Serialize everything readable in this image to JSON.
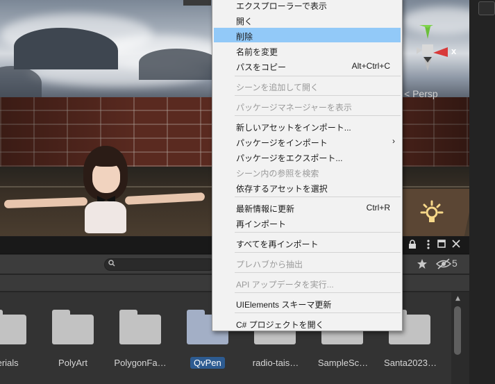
{
  "scene": {
    "projection_label": "< Persp",
    "gizmo_axis_label": "x"
  },
  "context_menu": {
    "items": [
      {
        "label": "エクスプローラーで表示",
        "shortcut": "",
        "disabled": false
      },
      {
        "label": "開く",
        "shortcut": "",
        "disabled": false
      },
      {
        "label": "削除",
        "shortcut": "",
        "disabled": false,
        "highlighted": true
      },
      {
        "label": "名前を変更",
        "shortcut": "",
        "disabled": false
      },
      {
        "label": "パスをコピー",
        "shortcut": "Alt+Ctrl+C",
        "disabled": false
      },
      {
        "label": "シーンを追加して開く",
        "shortcut": "",
        "disabled": true
      },
      {
        "label": "パッケージマネージャーを表示",
        "shortcut": "",
        "disabled": true
      },
      {
        "label": "新しいアセットをインポート...",
        "shortcut": "",
        "disabled": false
      },
      {
        "label": "パッケージをインポート",
        "shortcut": "",
        "disabled": false,
        "submenu": true
      },
      {
        "label": "パッケージをエクスポート...",
        "shortcut": "",
        "disabled": false
      },
      {
        "label": "シーン内の参照を検索",
        "shortcut": "",
        "disabled": true
      },
      {
        "label": "依存するアセットを選択",
        "shortcut": "",
        "disabled": false
      },
      {
        "label": "最新情報に更新",
        "shortcut": "Ctrl+R",
        "disabled": false
      },
      {
        "label": "再インポート",
        "shortcut": "",
        "disabled": false
      },
      {
        "label": "すべてを再インポート",
        "shortcut": "",
        "disabled": false
      },
      {
        "label": "プレハブから抽出",
        "shortcut": "",
        "disabled": true
      },
      {
        "label": "API アップデータを実行...",
        "shortcut": "",
        "disabled": true
      },
      {
        "label": "UIElements スキーマ更新",
        "shortcut": "",
        "disabled": false
      },
      {
        "label": "C# プロジェクトを開く",
        "shortcut": "",
        "disabled": false
      }
    ],
    "submenu_arrow": "›"
  },
  "project_panel": {
    "hidden_count": "5",
    "folders": [
      {
        "label": "terials",
        "selected": false
      },
      {
        "label": "PolyArt",
        "selected": false
      },
      {
        "label": "PolygonFa…",
        "selected": false
      },
      {
        "label": "QvPen",
        "selected": true
      },
      {
        "label": "radio-tais…",
        "selected": false
      },
      {
        "label": "SampleSc…",
        "selected": false
      },
      {
        "label": "Santa2023…",
        "selected": false
      }
    ]
  },
  "colors": {
    "menu_highlight": "#92c9f8",
    "selected_folder_label": "#2d5b91",
    "gizmo_y": "#6bbf3a",
    "gizmo_x": "#d83a3a"
  }
}
